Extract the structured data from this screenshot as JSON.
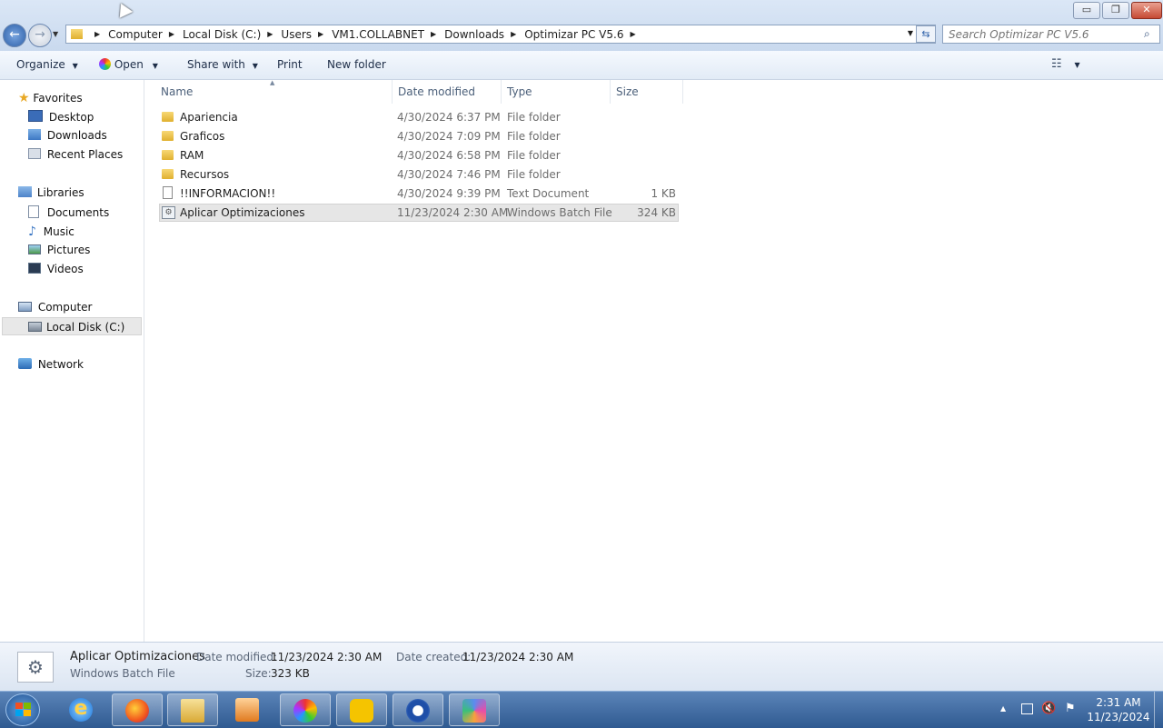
{
  "window": {
    "minimize_label": "▭",
    "restore_label": "❐",
    "close_label": "✕"
  },
  "address": {
    "crumbs": [
      "Computer",
      "Local Disk (C:)",
      "Users",
      "VM1.COLLABNET",
      "Downloads",
      "Optimizar PC V5.6"
    ]
  },
  "search": {
    "placeholder": "Search Optimizar PC V5.6"
  },
  "toolbar": {
    "organize": "Organize",
    "open": "Open",
    "share_with": "Share with",
    "print": "Print",
    "new_folder": "New folder"
  },
  "sidebar": {
    "favorites": "Favorites",
    "desktop": "Desktop",
    "downloads": "Downloads",
    "recent_places": "Recent Places",
    "libraries": "Libraries",
    "documents": "Documents",
    "music": "Music",
    "pictures": "Pictures",
    "videos": "Videos",
    "computer": "Computer",
    "local_disk": "Local Disk (C:)",
    "network": "Network"
  },
  "columns": {
    "name": "Name",
    "date_modified": "Date modified",
    "type": "Type",
    "size": "Size"
  },
  "files": [
    {
      "name": "Apariencia",
      "date": "4/30/2024 6:37 PM",
      "type": "File folder",
      "size": "",
      "icon": "folder-icon"
    },
    {
      "name": "Graficos",
      "date": "4/30/2024 7:09 PM",
      "type": "File folder",
      "size": "",
      "icon": "folder-icon"
    },
    {
      "name": "RAM",
      "date": "4/30/2024 6:58 PM",
      "type": "File folder",
      "size": "",
      "icon": "folder-icon"
    },
    {
      "name": "Recursos",
      "date": "4/30/2024 7:46 PM",
      "type": "File folder",
      "size": "",
      "icon": "folder-icon"
    },
    {
      "name": "!!INFORMACION!!",
      "date": "4/30/2024 9:39 PM",
      "type": "Text Document",
      "size": "1 KB",
      "icon": "text-document-icon"
    },
    {
      "name": "Aplicar Optimizaciones",
      "date": "11/23/2024 2:30 AM",
      "type": "Windows Batch File",
      "size": "324 KB",
      "icon": "batch-file-icon",
      "selected": true
    }
  ],
  "details": {
    "name": "Aplicar Optimizaciones",
    "type": "Windows Batch File",
    "date_modified_label": "Date modified:",
    "date_modified": "11/23/2024 2:30 AM",
    "date_created_label": "Date created:",
    "date_created": "11/23/2024 2:30 AM",
    "size_label": "Size:",
    "size": "323 KB"
  },
  "taskbar": {
    "time": "2:31 AM",
    "date": "11/23/2024",
    "apps": [
      "internet-explorer-icon",
      "firefox-icon",
      "file-explorer-icon",
      "media-player-icon",
      "color-wheel-app-icon",
      "lightshot-icon",
      "chrome-like-app-icon",
      "polygon-app-icon"
    ]
  }
}
